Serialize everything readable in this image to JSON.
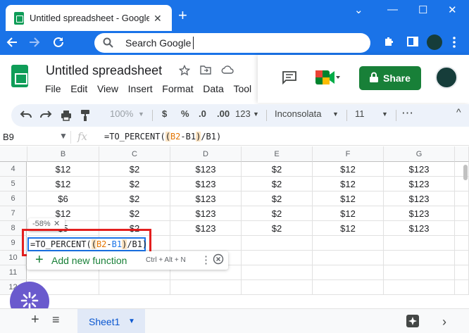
{
  "browser": {
    "tab_title": "Untitled spreadsheet - Google Sh",
    "tab_close": "✕",
    "new_tab": "+",
    "controls": [
      "⌄",
      "—",
      "☐",
      "✕"
    ],
    "omnibox_text": "Search Google"
  },
  "sheets": {
    "doc_title": "Untitled spreadsheet",
    "menu": [
      "File",
      "Edit",
      "View",
      "Insert",
      "Format",
      "Data",
      "Tool"
    ],
    "share_label": "Share",
    "toolbar": {
      "zoom": "100%",
      "currency": "$",
      "percent": "%",
      "dec_decrease": ".0",
      "dec_increase": ".00",
      "number_format": "123",
      "font": "Inconsolata",
      "font_size": "11",
      "more": "⋮"
    },
    "name_box": "B9",
    "fx": "fx",
    "formula": [
      "=TO_PERCENT(",
      "(",
      "B2",
      "-",
      "B1",
      ")",
      "/B1)"
    ],
    "columns": [
      "B",
      "C",
      "D",
      "E",
      "F",
      "G"
    ],
    "rows": [
      {
        "num": "4",
        "cells": [
          "$12",
          "$2",
          "$123",
          "$2",
          "$12",
          "$123"
        ]
      },
      {
        "num": "5",
        "cells": [
          "$12",
          "$2",
          "$123",
          "$2",
          "$12",
          "$123"
        ]
      },
      {
        "num": "6",
        "cells": [
          "$6",
          "$2",
          "$123",
          "$2",
          "$12",
          "$123"
        ]
      },
      {
        "num": "7",
        "cells": [
          "$12",
          "$2",
          "$123",
          "$2",
          "$12",
          "$123"
        ]
      },
      {
        "num": "8",
        "cells": [
          "$5",
          "$2",
          "$123",
          "$2",
          "$12",
          "$123"
        ]
      },
      {
        "num": "9",
        "cells": [
          "",
          "",
          "",
          "",
          "",
          ""
        ]
      },
      {
        "num": "10",
        "cells": [
          "",
          "",
          "",
          "",
          "",
          ""
        ]
      },
      {
        "num": "11",
        "cells": [
          "",
          "",
          "",
          "",
          "",
          ""
        ]
      },
      {
        "num": "12",
        "cells": [
          "",
          "",
          "",
          "",
          "",
          ""
        ]
      }
    ],
    "preview_value": "-58%",
    "preview_close": "✕",
    "add_function_label": "Add new function",
    "add_function_plus": "+",
    "add_function_shortcut": "Ctrl + Alt + N",
    "add_function_more": "⋮",
    "sheet_tab": "Sheet1",
    "sheet_add": "+",
    "sheet_list": "≡"
  },
  "colors": {
    "chrome_blue": "#1a73e8",
    "sheets_green": "#0f9d58",
    "share_green": "#188038",
    "highlight_red": "#e31f1f",
    "range_orange": "#e37400",
    "range_blue": "#1a73e8"
  }
}
